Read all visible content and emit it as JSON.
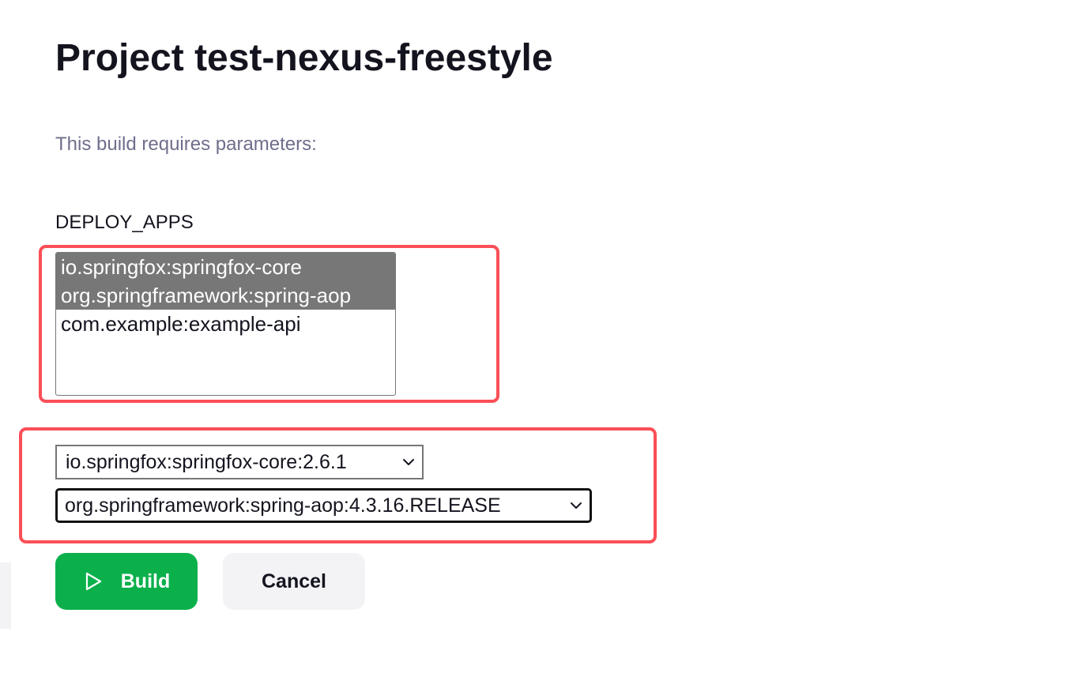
{
  "page": {
    "title": "Project test-nexus-freestyle",
    "subtitle": "This build requires parameters:"
  },
  "parameter": {
    "name": "DEPLOY_APPS",
    "options": [
      {
        "label": "io.springfox:springfox-core",
        "selected": true
      },
      {
        "label": "org.springframework:spring-aop",
        "selected": true
      },
      {
        "label": "com.example:example-api",
        "selected": false
      }
    ]
  },
  "version_selects": [
    {
      "value": "io.springfox:springfox-core:2.6.1",
      "icon": "chevron-down-icon"
    },
    {
      "value": "org.springframework:spring-aop:4.3.16.RELEASE",
      "icon": "chevron-down-icon",
      "focused": true
    }
  ],
  "actions": {
    "build_label": "Build",
    "build_icon": "play-icon",
    "cancel_label": "Cancel"
  },
  "colors": {
    "build_button": "#0bb04b",
    "highlight_border": "#fb4f57",
    "selected_option": "#777777",
    "subtitle_text": "#6e6e8c",
    "cancel_button": "#f3f3f6"
  }
}
